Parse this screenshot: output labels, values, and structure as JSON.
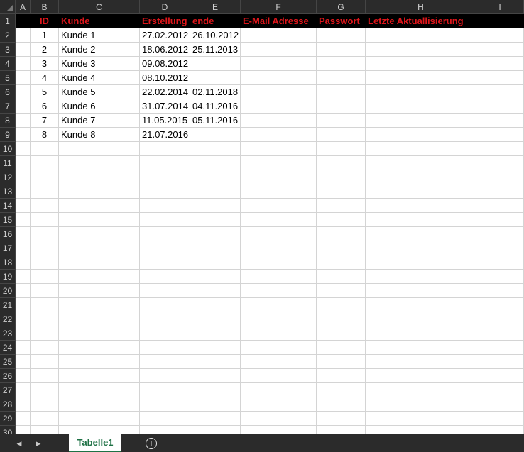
{
  "columns": [
    "A",
    "B",
    "C",
    "D",
    "E",
    "F",
    "G",
    "H",
    "I"
  ],
  "header_row": [
    "",
    "ID",
    "Kunde",
    "Erstellung",
    "ende",
    "E-Mail Adresse",
    "Passwort",
    "Letzte Aktuallisierung",
    ""
  ],
  "data_rows": [
    [
      "",
      "1",
      "Kunde 1",
      "27.02.2012",
      "26.10.2012",
      "",
      "",
      "",
      ""
    ],
    [
      "",
      "2",
      "Kunde 2",
      "18.06.2012",
      "25.11.2013",
      "",
      "",
      "",
      ""
    ],
    [
      "",
      "3",
      "Kunde 3",
      "09.08.2012",
      "",
      "",
      "",
      "",
      ""
    ],
    [
      "",
      "4",
      "Kunde 4",
      "08.10.2012",
      "",
      "",
      "",
      "",
      ""
    ],
    [
      "",
      "5",
      "Kunde 5",
      "22.02.2014",
      "02.11.2018",
      "",
      "",
      "",
      ""
    ],
    [
      "",
      "6",
      "Kunde 6",
      "31.07.2014",
      "04.11.2016",
      "",
      "",
      "",
      ""
    ],
    [
      "",
      "7",
      "Kunde 7",
      "11.05.2015",
      "05.11.2016",
      "",
      "",
      "",
      ""
    ],
    [
      "",
      "8",
      "Kunde 8",
      "21.07.2016",
      "",
      "",
      "",
      "",
      ""
    ]
  ],
  "row_numbers": [
    "1",
    "2",
    "3",
    "4",
    "5",
    "6",
    "7",
    "8",
    "9",
    "10",
    "11",
    "12",
    "13",
    "14",
    "15",
    "16",
    "17",
    "18",
    "19",
    "20",
    "21",
    "22",
    "23",
    "24",
    "25",
    "26",
    "27",
    "28",
    "29",
    "30"
  ],
  "sheet_tabs": [
    "Tabelle1"
  ],
  "icons": {
    "prev": "caret-left-icon",
    "next": "caret-right-icon",
    "add": "plus-circle-icon"
  },
  "colors": {
    "header_fill": "#000000",
    "header_text": "#e0161b",
    "tab_text": "#1e7145"
  }
}
